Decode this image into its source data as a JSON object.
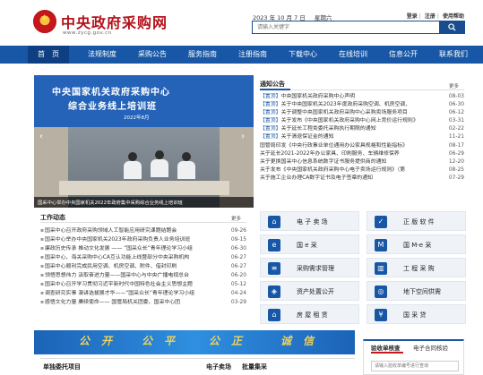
{
  "header": {
    "site_title": "中央政府采购网",
    "site_url": "www.zycg.gov.cn",
    "date": "2023 年 10 月 7 日",
    "weekday": "星期六",
    "login": "登录",
    "register": "注册",
    "help": "使用帮助",
    "search_placeholder": "请输入关键字"
  },
  "nav": {
    "items": [
      {
        "label": "首　页"
      },
      {
        "label": "法规制度"
      },
      {
        "label": "采购公告"
      },
      {
        "label": "服务指南"
      },
      {
        "label": "注册指南"
      },
      {
        "label": "下载中心"
      },
      {
        "label": "在线培训"
      },
      {
        "label": "信息公开"
      },
      {
        "label": "联系我们"
      }
    ]
  },
  "slider": {
    "banner_line1": "中央国家机关政府采购中心",
    "banner_line2": "综合业务线上培训班",
    "banner_date": "2022年8月",
    "caption": "国采中心举办中央国家机关2022年政府集中采购综合业务线上培训班"
  },
  "notice": {
    "title": "通知公告",
    "more": "更多",
    "items": [
      {
        "tag": "【置顶】",
        "text": "中央国家机关政府采购中心声明",
        "date": "08-03"
      },
      {
        "tag": "【置顶】",
        "text": "关于中央国家机关2023年度政府采购空调、机房空调、",
        "date": "06-30"
      },
      {
        "tag": "【置顶】",
        "text": "关于调整中央国家机关政府采购中心采购卖场服务项目",
        "date": "06-12"
      },
      {
        "tag": "【置顶】",
        "text": "关于发布《中央国家机关政府采购中心网上竞价运行规则》",
        "date": "03-31"
      },
      {
        "tag": "【置顶】",
        "text": "关于延长工程类委托采购执行期限的通知",
        "date": "02-22"
      },
      {
        "tag": "【置顶】",
        "text": "关于清退保证金的通知",
        "date": "11-21"
      },
      {
        "tag": "",
        "text": "国管局印发《中央行政事业单位通用办公家具规格和性能指标》",
        "date": "08-17"
      },
      {
        "tag": "",
        "text": "关于延长2021-2022年办公家具、印刷服务、车辆维修保养",
        "date": "06-29"
      },
      {
        "tag": "",
        "text": "关于更换国采中心信息系统数字证书服务提供商的通知",
        "date": "12-20"
      },
      {
        "tag": "",
        "text": "关于发布《中央国家机关政府采购中心电子卖场运行规则》（第",
        "date": "08-25"
      },
      {
        "tag": "",
        "text": "关于施工企业办理CA数字证书及电子签章的通知",
        "date": "07-29"
      }
    ]
  },
  "work": {
    "title": "工作动态",
    "more": "更多",
    "items": [
      {
        "text": "国采中心召开政府采购领域人工智能应用研究课题结题会",
        "date": "09-26"
      },
      {
        "text": "国采中心举办中央国家机关2023年政府采购负责人业务培训班",
        "date": "09-15"
      },
      {
        "text": "廉政历史传承 推动文化发展 —— “国采众长”青年理论学习小组",
        "date": "06-30"
      },
      {
        "text": "国采中心、海关采购中心CA互认功能上线暨部分中央采购机构",
        "date": "06-27"
      },
      {
        "text": "国采中心顺利完成民用空调、机房空调、附件、借封印刷",
        "date": "06-27"
      },
      {
        "text": "领悟思想伟力 汲取奋进力量——国采中心与中央广播电视总台",
        "date": "06-20"
      },
      {
        "text": "国采中心召开学习贯彻习近平新时代中国特色社会主义思想主题",
        "date": "05-12"
      },
      {
        "text": "调查研究实事 演讲选拔展才华——“国采众长”青年理论学习小组",
        "date": "04-24"
      },
      {
        "text": "感悟文化力量 赓续使命—— 国管局机关团委、国采中心团",
        "date": "03-29"
      }
    ]
  },
  "services": [
    {
      "label": "电 子 卖 场",
      "icon": "cart-icon",
      "glyph": "⌂"
    },
    {
      "label": "正 版 软 件",
      "icon": "shield-icon",
      "glyph": "✓"
    },
    {
      "label": "国 e 采",
      "icon": "e-icon",
      "glyph": "e"
    },
    {
      "label": "国 M-e 采",
      "icon": "m-icon",
      "glyph": "M"
    },
    {
      "label": "采购需求管理",
      "icon": "list-icon",
      "glyph": "≡"
    },
    {
      "label": "工 程 采 购",
      "icon": "building-icon",
      "glyph": "▥"
    },
    {
      "label": "资产处置公开",
      "icon": "asset-icon",
      "glyph": "◈"
    },
    {
      "label": "地下空间供需",
      "icon": "map-icon",
      "glyph": "◎"
    },
    {
      "label": "房 屋 租 赁",
      "icon": "house-icon",
      "glyph": "⌂"
    },
    {
      "label": "国 采 贷",
      "icon": "money-icon",
      "glyph": "¥"
    }
  ],
  "banner": {
    "words": [
      "公",
      "开",
      "公",
      "平",
      "公",
      "正",
      "诚",
      "信"
    ]
  },
  "verify": {
    "tab1": "验收单核查",
    "tab2": "电子合同核验",
    "placeholder": "请输入验收单编号进行查询"
  },
  "bottom": {
    "left_heading": "单独委托项目",
    "mid_heading1": "电子卖场",
    "mid_heading2": "批量集采"
  },
  "colors": {
    "nav": "#1757a6",
    "brand_red": "#b3121a",
    "accent_blue": "#1757a6"
  }
}
